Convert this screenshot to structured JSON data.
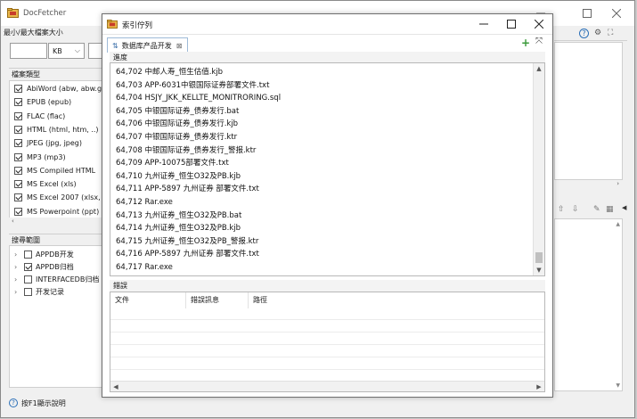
{
  "main": {
    "title": "DocFetcher",
    "size_section": {
      "label": "最小/最大檔案大小",
      "unit": "KB"
    },
    "filetypes": {
      "label": "檔案類型",
      "items": [
        {
          "label": "AbiWord (abw, abw.g",
          "checked": true
        },
        {
          "label": "EPUB (epub)",
          "checked": true
        },
        {
          "label": "FLAC (flac)",
          "checked": true
        },
        {
          "label": "HTML (html, htm, ..)",
          "checked": true
        },
        {
          "label": "JPEG (jpg, jpeg)",
          "checked": true
        },
        {
          "label": "MP3 (mp3)",
          "checked": true
        },
        {
          "label": "MS Compiled HTML",
          "checked": true
        },
        {
          "label": "MS Excel (xls)",
          "checked": true
        },
        {
          "label": "MS Excel 2007 (xlsx, :",
          "checked": true
        },
        {
          "label": "MS Powerpoint (ppt)",
          "checked": true
        }
      ]
    },
    "search_scope": {
      "label": "搜尋範圍",
      "items": [
        {
          "label": "APPDB开发",
          "checked": false
        },
        {
          "label": "APPDB归档",
          "checked": true
        },
        {
          "label": "INTERFACEDB归档",
          "checked": false
        },
        {
          "label": "开发记录",
          "checked": false
        }
      ]
    },
    "status_bar": "按F1顯示說明"
  },
  "dialog": {
    "title": "索引佇列",
    "tab_label": "数据库产品开发",
    "progress_label": "進度",
    "progress_rows": [
      "64,702 中邮人寿_恒生估值.kjb",
      "64,703 APP-6031中银国际证券部署文件.txt",
      "64,704 HSJY_JKK_KELLTE_MONITRORING.sql",
      "64,705 中银国际证券_债券发行.bat",
      "64,706 中银国际证券_债券发行.kjb",
      "64,707 中银国际证券_债券发行.ktr",
      "64,708 中银国际证券_债券发行_警报.ktr",
      "64,709 APP-10075部署文件.txt",
      "64,710 九州证券_恒生O32及PB.kjb",
      "64,711 APP-5897 九州证券 部署文件.txt",
      "64,712 Rar.exe",
      "64,713 九州证券_恒生O32及PB.bat",
      "64,714 九州证券_恒生O32及PB.kjb",
      "64,715 九州证券_恒生O32及PB_警报.ktr",
      "64,716 APP-5897 九州证券 部署文件.txt",
      "64,717 Rar.exe"
    ],
    "errors_label": "錯誤",
    "error_columns": [
      "文件",
      "錯誤訊息",
      "路徑"
    ]
  },
  "colors": {
    "window_bg": "#f0f0f0",
    "accent_tab_border": "#9fbbd8",
    "icon_green": "#3a9a3a",
    "help_blue": "#2a6fb8"
  }
}
